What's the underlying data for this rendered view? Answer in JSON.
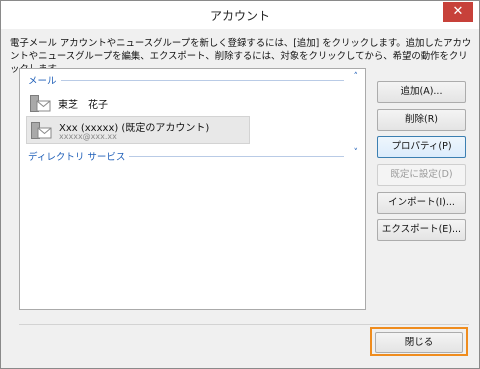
{
  "window": {
    "title": "アカウント",
    "close_glyph": "✕"
  },
  "description": "電子メール アカウントやニュースグループを新しく登録するには、[追加] をクリックします。追加したアカウントやニュースグループを編集、エクスポート、削除するには、対象をクリックしてから、希望の動作をクリックします。",
  "list": {
    "groups": [
      {
        "label": "メール",
        "chevron": "˄"
      },
      {
        "label": "ディレクトリ サービス",
        "chevron": "˅"
      }
    ],
    "accounts": [
      {
        "name": "東芝　花子",
        "sub": ""
      },
      {
        "name": "Xxx (xxxxx) (既定のアカウント)",
        "sub": "xxxxx@xxx.xx"
      }
    ]
  },
  "buttons": {
    "add": "追加(A)...",
    "delete": "削除(R)",
    "properties": "プロパティ(P)",
    "set_default": "既定に設定(D)",
    "import": "インポート(I)...",
    "export": "エクスポート(E)...",
    "close": "閉じる"
  },
  "colors": {
    "highlight": "#ef8c1e",
    "link": "#1f5fb8"
  }
}
